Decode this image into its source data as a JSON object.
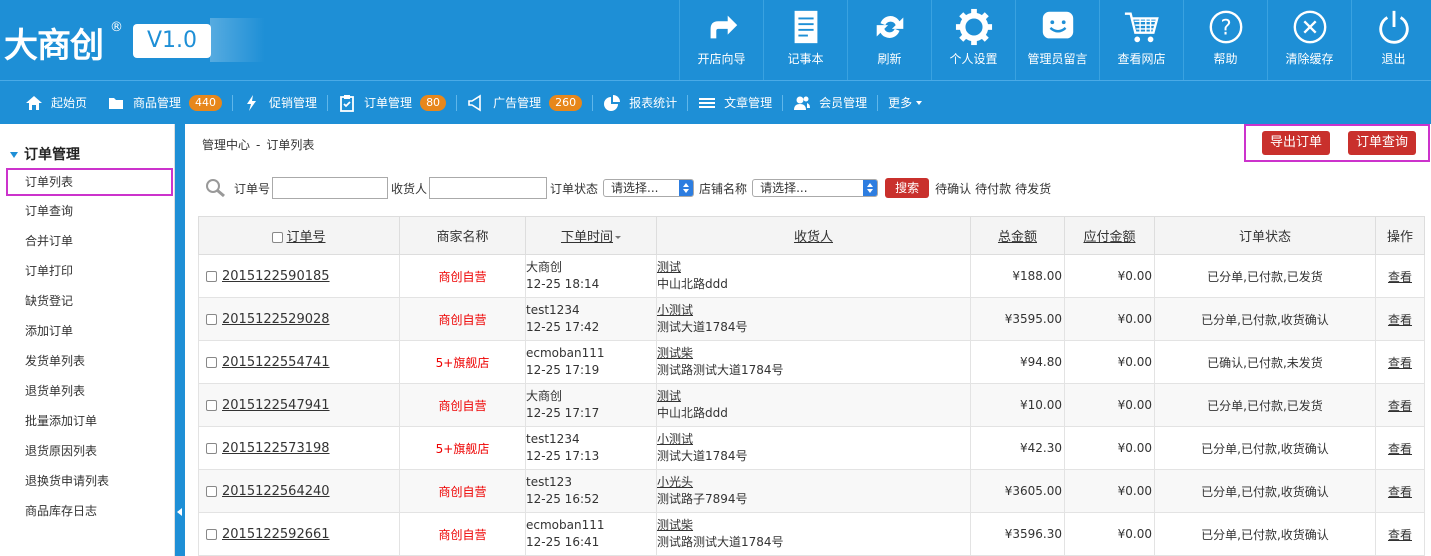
{
  "logo": {
    "text": "大商创",
    "reg": "®",
    "version": "V1.0"
  },
  "top_nav": [
    {
      "label": "开店向导",
      "icon": "share-arrow-icon"
    },
    {
      "label": "记事本",
      "icon": "notepad-icon"
    },
    {
      "label": "刷新",
      "icon": "refresh-icon"
    },
    {
      "label": "个人设置",
      "icon": "gear-icon"
    },
    {
      "label": "管理员留言",
      "icon": "message-smile-icon"
    },
    {
      "label": "查看网店",
      "icon": "cart-icon"
    },
    {
      "label": "帮助",
      "icon": "help-icon"
    },
    {
      "label": "清除缓存",
      "icon": "clear-cache-icon"
    },
    {
      "label": "退出",
      "icon": "power-icon"
    }
  ],
  "main_nav": [
    {
      "label": "起始页",
      "icon": "home-icon",
      "badge": ""
    },
    {
      "label": "商品管理",
      "icon": "folder-icon",
      "badge": "440"
    },
    {
      "label": "促销管理",
      "icon": "lightning-icon",
      "badge": ""
    },
    {
      "label": "订单管理",
      "icon": "clipboard-icon",
      "badge": "80"
    },
    {
      "label": "广告管理",
      "icon": "megaphone-icon",
      "badge": "260"
    },
    {
      "label": "报表统计",
      "icon": "pie-chart-icon",
      "badge": ""
    },
    {
      "label": "文章管理",
      "icon": "list-icon",
      "badge": ""
    },
    {
      "label": "会员管理",
      "icon": "users-icon",
      "badge": ""
    },
    {
      "label": "更多",
      "icon": "caret-down-icon",
      "badge": ""
    }
  ],
  "sidebar": {
    "title": "订单管理",
    "items": [
      "订单列表",
      "订单查询",
      "合并订单",
      "订单打印",
      "缺货登记",
      "添加订单",
      "发货单列表",
      "退货单列表",
      "批量添加订单",
      "退货原因列表",
      "退换货申请列表",
      "商品库存日志"
    ],
    "active_index": 0
  },
  "breadcrumb": {
    "root": "管理中心",
    "sep": "-",
    "current": "订单列表"
  },
  "actions": {
    "export": "导出订单",
    "query": "订单查询"
  },
  "filter": {
    "order_sn_label": "订单号",
    "order_sn_value": "",
    "consignee_label": "收货人",
    "consignee_value": "",
    "status_label": "订单状态",
    "status_value": "请选择...",
    "shop_label": "店铺名称",
    "shop_value": "请选择...",
    "search_button": "搜索",
    "quick_links": [
      "待确认",
      "待付款",
      "待发货"
    ]
  },
  "table": {
    "headers": {
      "order_sn": "订单号",
      "shop": "商家名称",
      "time": "下单时间",
      "consignee": "收货人",
      "total": "总金额",
      "payable": "应付金额",
      "status": "订单状态",
      "op": "操作"
    },
    "rows": [
      {
        "sn": "2015122590185",
        "shop": "商创自营",
        "user": "大商创",
        "time": "12-25 18:14",
        "cname": "测试",
        "addr": "中山北路ddd",
        "total": "¥188.00",
        "payable": "¥0.00",
        "status": "已分单,已付款,已发货",
        "op": "查看"
      },
      {
        "sn": "2015122529028",
        "shop": "商创自营",
        "user": "test1234",
        "time": "12-25 17:42",
        "cname": "小测试",
        "addr": "测试大道1784号",
        "total": "¥3595.00",
        "payable": "¥0.00",
        "status": "已分单,已付款,收货确认",
        "op": "查看"
      },
      {
        "sn": "2015122554741",
        "shop": "5+旗舰店",
        "user": "ecmoban111",
        "time": "12-25 17:19",
        "cname": "测试柴",
        "addr": "测试路测试大道1784号",
        "total": "¥94.80",
        "payable": "¥0.00",
        "status": "已确认,已付款,未发货",
        "op": "查看"
      },
      {
        "sn": "2015122547941",
        "shop": "商创自营",
        "user": "大商创",
        "time": "12-25 17:17",
        "cname": "测试",
        "addr": "中山北路ddd",
        "total": "¥10.00",
        "payable": "¥0.00",
        "status": "已分单,已付款,已发货",
        "op": "查看"
      },
      {
        "sn": "2015122573198",
        "shop": "5+旗舰店",
        "user": "test1234",
        "time": "12-25 17:13",
        "cname": "小测试",
        "addr": "测试大道1784号",
        "total": "¥42.30",
        "payable": "¥0.00",
        "status": "已分单,已付款,收货确认",
        "op": "查看"
      },
      {
        "sn": "2015122564240",
        "shop": "商创自营",
        "user": "test123",
        "time": "12-25 16:52",
        "cname": "小光头",
        "addr": "测试路子7894号",
        "total": "¥3605.00",
        "payable": "¥0.00",
        "status": "已分单,已付款,收货确认",
        "op": "查看"
      },
      {
        "sn": "2015122592661",
        "shop": "商创自营",
        "user": "ecmoban111",
        "time": "12-25 16:41",
        "cname": "测试柴",
        "addr": "测试路测试大道1784号",
        "total": "¥3596.30",
        "payable": "¥0.00",
        "status": "已分单,已付款,收货确认",
        "op": "查看"
      }
    ]
  },
  "colors": {
    "brand_blue": "#1e8fd6",
    "badge_orange": "#e7871b",
    "button_red": "#c9302c",
    "highlight_magenta": "#cc33cc",
    "shop_red": "#ee0000"
  }
}
